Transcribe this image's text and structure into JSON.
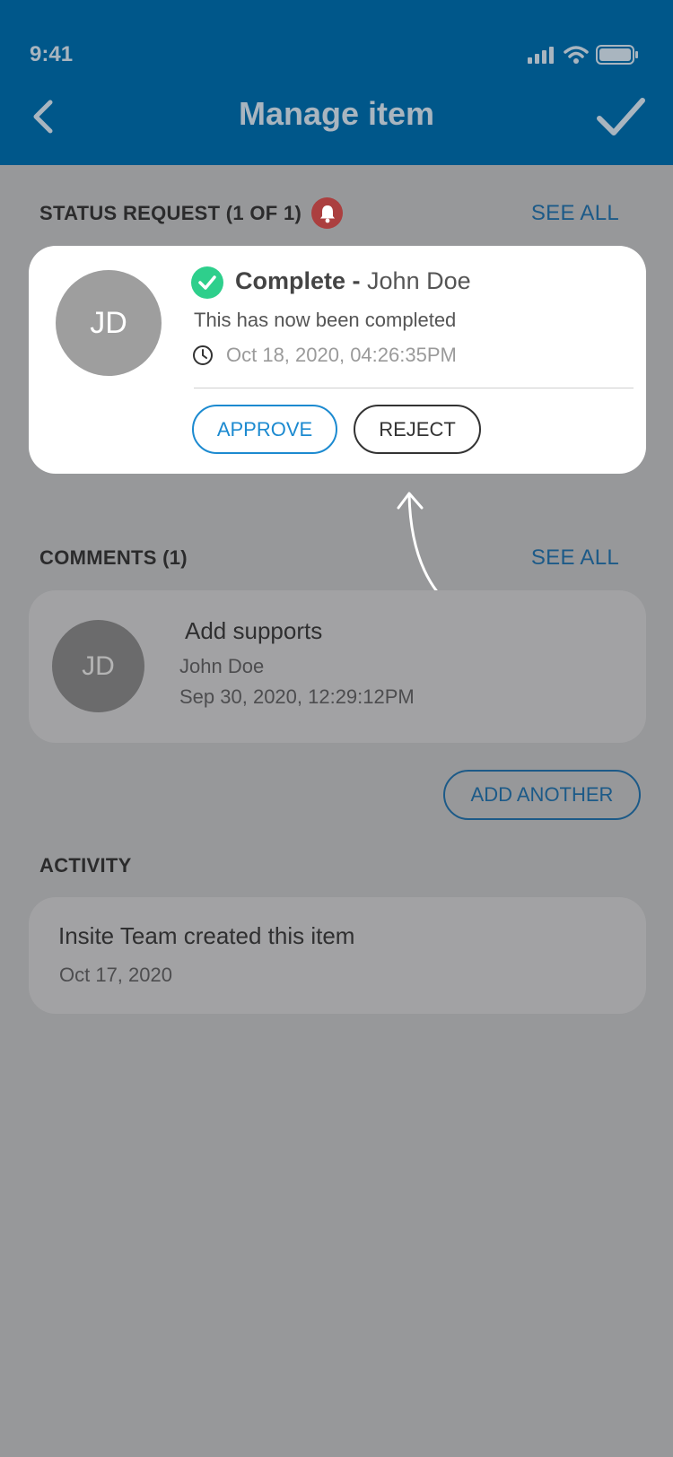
{
  "status_bar": {
    "time": "9:41"
  },
  "header": {
    "title": "Manage item"
  },
  "status_request": {
    "section_title": "STATUS REQUEST (1 OF 1)",
    "see_all": "SEE ALL",
    "card": {
      "avatar_initials": "JD",
      "status": "Complete -",
      "user": "John Doe",
      "description": "This has now been completed",
      "datetime": "Oct 18, 2020, 04:26:35PM",
      "approve_label": "APPROVE",
      "reject_label": "REJECT"
    }
  },
  "comments": {
    "section_title": "COMMENTS (1)",
    "see_all": "SEE ALL",
    "items": [
      {
        "avatar_initials": "JD",
        "title": "Add supports",
        "author": "John Doe",
        "datetime": "Sep 30, 2020, 12:29:12PM"
      }
    ],
    "add_another_label": "ADD ANOTHER"
  },
  "activity": {
    "section_title": "ACTIVITY",
    "items": [
      {
        "text": "Insite Team created this item",
        "date": "Oct 17, 2020"
      }
    ]
  },
  "colors": {
    "header_bg": "#00578a",
    "overlay_bg": "#97989a",
    "accent_blue": "#1c8ad0",
    "complete_green": "#2ecf8c",
    "alert_red": "#ab3f3f"
  }
}
